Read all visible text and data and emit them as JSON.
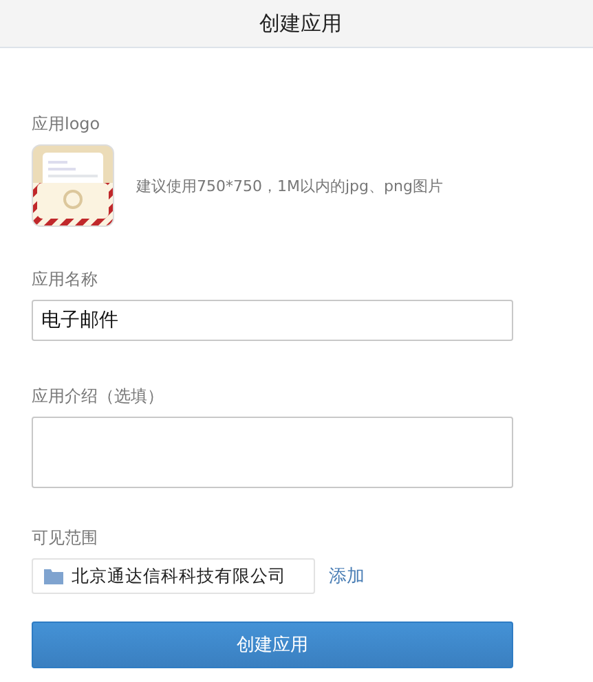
{
  "header": {
    "title": "创建应用"
  },
  "logo": {
    "label": "应用logo",
    "hint": "建议使用750*750，1M以内的jpg、png图片"
  },
  "name": {
    "label": "应用名称",
    "value": "电子邮件"
  },
  "intro": {
    "label": "应用介绍（选填）"
  },
  "scope": {
    "label": "可见范围",
    "items": [
      {
        "text": "北京通达信科科技有限公司"
      }
    ],
    "add": "添加"
  },
  "submit": "创建应用"
}
